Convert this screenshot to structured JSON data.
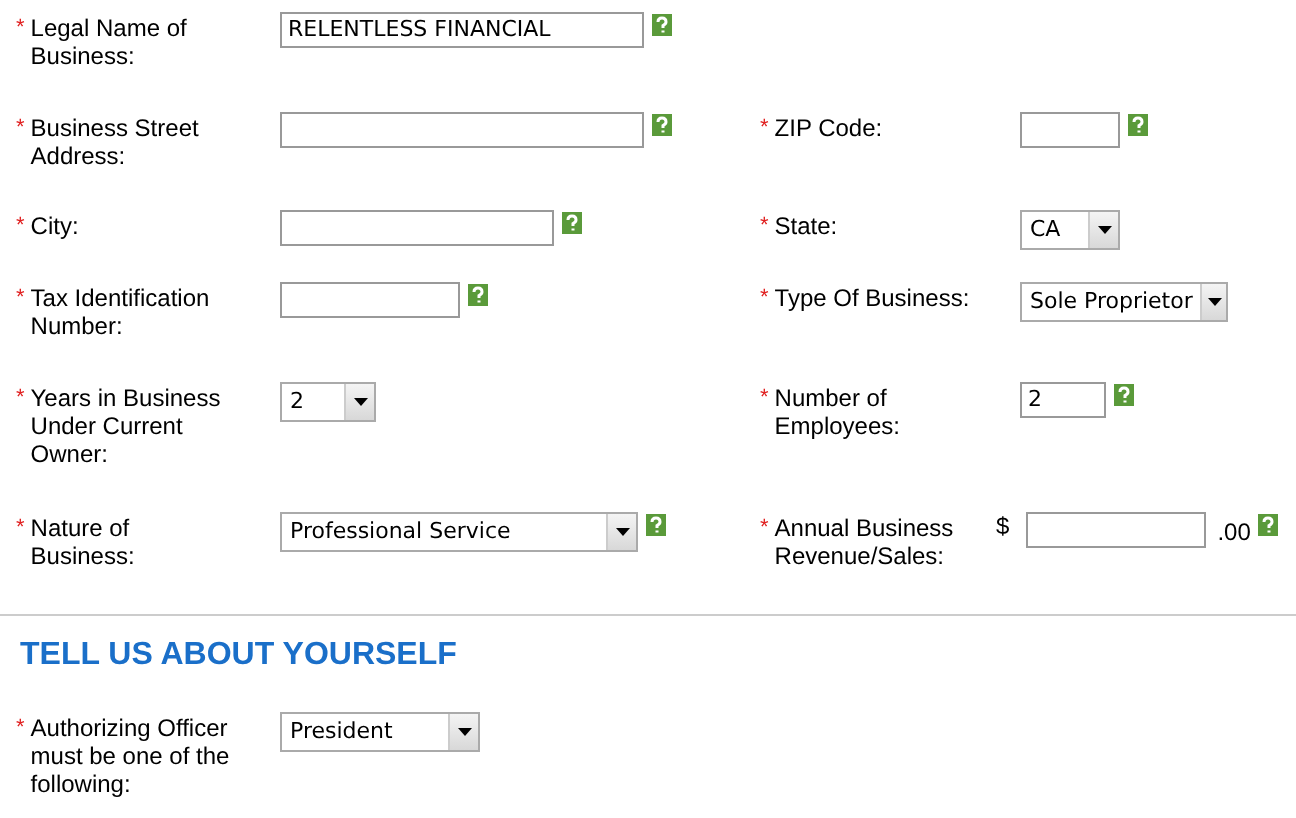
{
  "rows": [
    {
      "left": {
        "required_mark": "*",
        "label": "Legal Name of Business:",
        "kind": "text",
        "value": "RELENTLESS FINANCIAL",
        "help": true
      }
    },
    {
      "left": {
        "required_mark": "*",
        "label": "Business Street Address:",
        "kind": "text",
        "help": true
      },
      "right": {
        "required_mark": "*",
        "label": "ZIP Code:",
        "kind": "text",
        "help": true
      }
    },
    {
      "left": {
        "required_mark": "*",
        "label": "City:",
        "kind": "text",
        "help": true
      },
      "right": {
        "required_mark": "*",
        "label": "State:",
        "kind": "select",
        "value": "CA",
        "help": false
      }
    },
    {
      "left": {
        "required_mark": "*",
        "label": "Tax Identification Number:",
        "kind": "text",
        "help": true
      },
      "right": {
        "required_mark": "*",
        "label": "Type Of Business:",
        "kind": "select",
        "value": "Sole Proprietor",
        "help": false
      }
    },
    {
      "left": {
        "required_mark": "*",
        "label": "Years in Business Under Current Owner:",
        "kind": "select",
        "value": "2",
        "help": false
      },
      "right": {
        "required_mark": "*",
        "label": "Number of Employees:",
        "kind": "text",
        "value": "2",
        "help": true
      }
    },
    {
      "left": {
        "required_mark": "*",
        "label": "Nature of Business:",
        "kind": "select",
        "value": "Professional Service",
        "help": true
      },
      "right": {
        "required_mark": "*",
        "label": "Annual Business Revenue/Sales:",
        "kind": "money",
        "prefix": "$",
        "suffix": ".00",
        "help": true
      }
    }
  ],
  "section": {
    "heading": "TELL US ABOUT YOURSELF",
    "rows": [
      {
        "left": {
          "required_mark": "*",
          "label": "Authorizing Officer must be one of the following:",
          "kind": "select",
          "value": "President",
          "help": false
        }
      }
    ]
  }
}
